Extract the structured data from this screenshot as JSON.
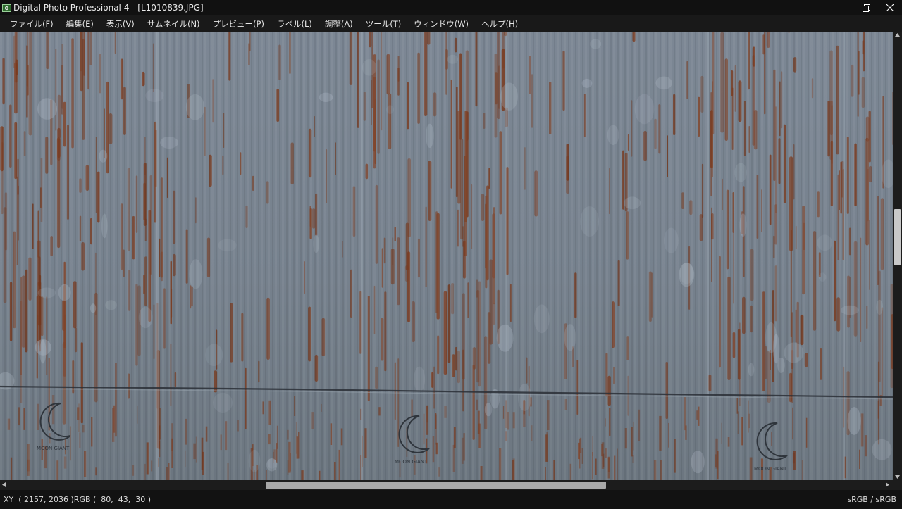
{
  "window": {
    "title": "Digital Photo Professional 4 - [L1010839.JPG]",
    "icon": "dpp-app-icon"
  },
  "menu": {
    "items": [
      {
        "label": "ファイル(F)"
      },
      {
        "label": "編集(E)"
      },
      {
        "label": "表示(V)"
      },
      {
        "label": "サムネイル(N)"
      },
      {
        "label": "プレビュー(P)"
      },
      {
        "label": "ラベル(L)"
      },
      {
        "label": "調整(A)"
      },
      {
        "label": "ツール(T)"
      },
      {
        "label": "ウィンドウ(W)"
      },
      {
        "label": "ヘルプ(H)"
      }
    ]
  },
  "viewer": {
    "image_subject": "rusted corrugated metal wall",
    "logo_text": "MOON GIANT",
    "colors": {
      "metal": "#7a8591",
      "rust": "#7a3a1e",
      "seam": "#2a2f36"
    }
  },
  "scrollbars": {
    "vertical_position": 0.4,
    "horizontal_position": 0.4
  },
  "status": {
    "readout": "XY  ( 2157, 2036 )RGB (  80,  43,  30 )",
    "color_space": "sRGB / sRGB"
  }
}
